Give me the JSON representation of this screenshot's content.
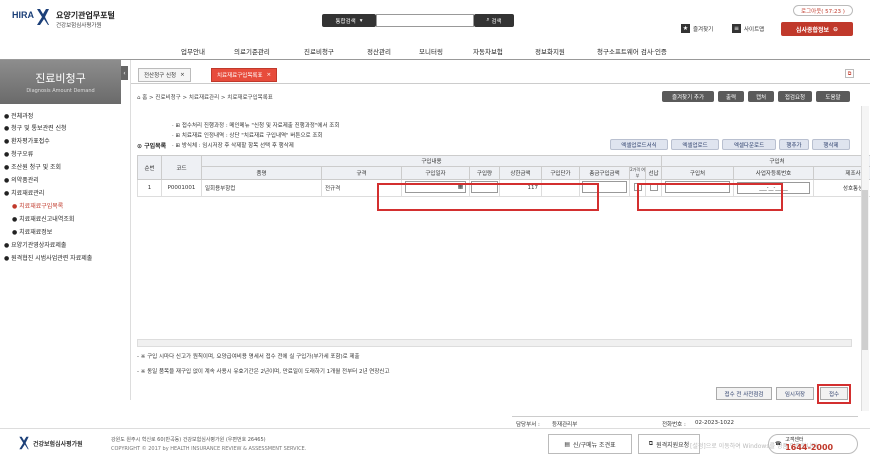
{
  "header": {
    "logo_mark": "HIRA",
    "logo_title": "요양기관업무포털",
    "logo_subtitle": "건강보험심사평가원",
    "search_scope": "통합검색",
    "search_button": "검색",
    "logout": "로그아웃( 57:23 )",
    "favorites": "즐겨찾기",
    "sitemap": "사이트맵",
    "org_info": "심사종합정보"
  },
  "menu": [
    "업무안내",
    "의료기준관리",
    "진료비청구",
    "정산관리",
    "모니터링",
    "자동차보험",
    "정보화지원",
    "청구소프트웨어 검사·인증"
  ],
  "leftnav": {
    "title": "진료비청구",
    "subtitle": "Diagnosis Amount Demand",
    "items": [
      {
        "label": "전체과정"
      },
      {
        "label": "청구 및 통보관련 신청"
      },
      {
        "label": "환자평가표접수"
      },
      {
        "label": "청구오류"
      },
      {
        "label": "조산원 청구 및 조회"
      },
      {
        "label": "의약품관리"
      },
      {
        "label": "치료재료관리"
      },
      {
        "label": "치료재료구입목록"
      },
      {
        "label": "치료재료신고내역조회"
      },
      {
        "label": "치료재료정보"
      },
      {
        "label": "요양기관영상자료제출"
      },
      {
        "label": "원격협진 시범사업관련 자료제출"
      }
    ]
  },
  "tabs": [
    {
      "label": "전산청구 신청"
    },
    {
      "label": "치료재료구입목록표"
    }
  ],
  "breadcrumb": "홈 > 진료비청구 > 치료재료관리 > 치료재료구입목록표",
  "toolbar": {
    "fav_add": "즐겨찾기 추가",
    "print": "출력",
    "capture": "캡처",
    "help": "접검요청",
    "guide": "도움말"
  },
  "notes": [
    "· ⊞ 접수처리 진행과정 : 메인메뉴 \"신청 및 자료제출 진행과정\"에서 조회",
    "· ⊞ 치료재료 인정내역 : 상단 \"치료재료 구입내역\" 버튼으로 조회",
    "· ⊞ 방식체 : 임시저장 후 삭제할 항목 선택 후 행삭제"
  ],
  "section_title": "구입목록",
  "grid_buttons": [
    "엑셀업로드서식",
    "엑셀업로드",
    "엑셀다운로드",
    "행추가",
    "행삭제"
  ],
  "grid": {
    "group1": "구입내용",
    "group2": "구입처",
    "headers": [
      "순번",
      "코드",
      "품명",
      "규격",
      "구입일자",
      "구입량",
      "상한금액",
      "구입단가",
      "총금구입금액",
      "2가격\n여부",
      "선납",
      "구입처",
      "사업자등록번호",
      "제조사"
    ],
    "row": {
      "no": "1",
      "code": "P0001001",
      "name": "일회용부항컵",
      "spec": "전규격",
      "limit": "117",
      "biz_no": "___-__-_____",
      "maker": "성호통상"
    }
  },
  "footnotes": [
    "- ※ 구입 시마다 신고가 원칙이며, 요양급여비용 명세서 접수 전에 실 구입가(부가세 포함)로 제출",
    "- ※ 동일 품목을 재구입 없이 계속 사용시 유효기간은 2년이며, 만료일이 도래하기 1개월 전부터 2년 연장신고"
  ],
  "bottom_buttons": {
    "precheck": "접수 전 사전점검",
    "temp_save": "임시저장",
    "submit": "접수"
  },
  "contact": {
    "dept_label": "담당부서 :",
    "dept": "등재관리부",
    "phone_label": "전화번호 :",
    "phone": "02-2023-1022"
  },
  "footer": {
    "org": "건강보험심사평가원",
    "address": "강원도 원주시 혁신로 60(반곡동) 건강보험심사평가원 (우편번호 26465)",
    "copyright": "COPYRIGHT © 2017 by HEALTH INSURANCE REVIEW & ASSESSMENT SERVICE.",
    "btn1": "신/구메뉴 조견표",
    "btn2": "원격지원요청",
    "center_label": "고객센터",
    "center_number": "1644-2000",
    "watermark": "[설정]으로 이동하여 Windows를 정품 인증합니다."
  }
}
